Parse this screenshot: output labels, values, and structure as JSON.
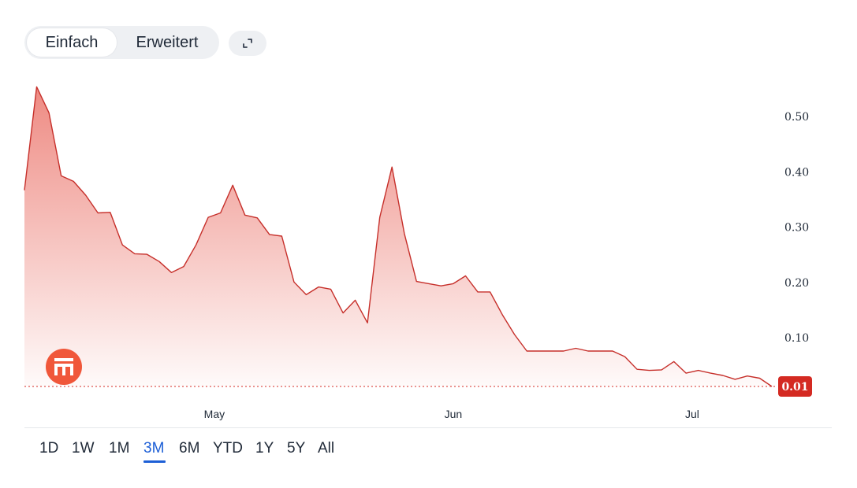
{
  "modes": [
    {
      "label": "Einfach",
      "active": true
    },
    {
      "label": "Erweitert",
      "active": false
    }
  ],
  "expand_icon": "expand-icon",
  "logo_icon": "bank-icon",
  "colors": {
    "line": "#c62f2a",
    "fill_top": "#ee8a82",
    "last_badge": "#d42a22",
    "active_range": "#1d5fd6"
  },
  "chart_data": {
    "type": "area",
    "x_ticks": [
      {
        "label": "May",
        "index": 15.5
      },
      {
        "label": "Jun",
        "index": 35
      },
      {
        "label": "Jul",
        "index": 54.5
      }
    ],
    "y_ticks": [
      "0.10",
      "0.20",
      "0.30",
      "0.40",
      "0.50"
    ],
    "y_tick_values": [
      0.1,
      0.2,
      0.3,
      0.4,
      0.5
    ],
    "ylim": [
      0.012,
      0.563
    ],
    "last_value_label": "0.01",
    "last_value": 0.012,
    "values": [
      0.367,
      0.554,
      0.507,
      0.393,
      0.383,
      0.358,
      0.326,
      0.327,
      0.268,
      0.252,
      0.251,
      0.238,
      0.218,
      0.229,
      0.268,
      0.318,
      0.326,
      0.376,
      0.322,
      0.317,
      0.287,
      0.284,
      0.201,
      0.178,
      0.192,
      0.188,
      0.145,
      0.168,
      0.127,
      0.318,
      0.409,
      0.289,
      0.202,
      0.198,
      0.194,
      0.198,
      0.212,
      0.183,
      0.183,
      0.142,
      0.106,
      0.076,
      0.076,
      0.076,
      0.076,
      0.081,
      0.076,
      0.076,
      0.076,
      0.066,
      0.043,
      0.041,
      0.042,
      0.057,
      0.036,
      0.041,
      0.036,
      0.032,
      0.025,
      0.031,
      0.027,
      0.012
    ]
  },
  "ranges": [
    {
      "label": "1D",
      "active": false
    },
    {
      "label": "1W",
      "active": false
    },
    {
      "label": "1M",
      "active": false
    },
    {
      "label": "3M",
      "active": true
    },
    {
      "label": "6M",
      "active": false
    },
    {
      "label": "YTD",
      "active": false
    },
    {
      "label": "1Y",
      "active": false
    },
    {
      "label": "5Y",
      "active": false
    },
    {
      "label": "All",
      "active": false
    }
  ]
}
